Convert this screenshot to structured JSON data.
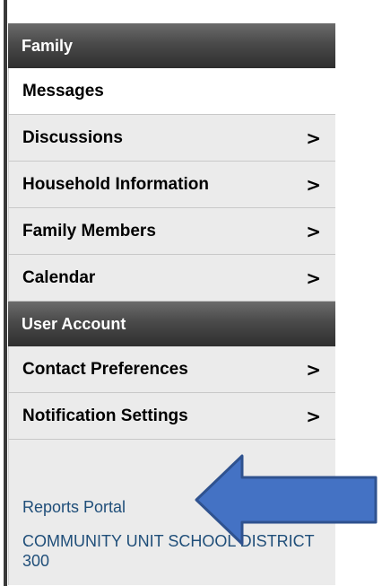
{
  "sidebar": {
    "family_header": "Family",
    "family_items": [
      {
        "label": "Messages",
        "arrow": ""
      },
      {
        "label": "Discussions",
        "arrow": ">"
      },
      {
        "label": "Household Information",
        "arrow": ">"
      },
      {
        "label": "Family Members",
        "arrow": ">"
      },
      {
        "label": "Calendar",
        "arrow": ">"
      }
    ],
    "user_header": "User Account",
    "user_items": [
      {
        "label": "Contact Preferences",
        "arrow": ">"
      },
      {
        "label": "Notification Settings",
        "arrow": ">"
      }
    ],
    "links": {
      "reports_portal": "Reports Portal",
      "district": "COMMUNITY UNIT SCHOOL DISTRICT 300"
    }
  },
  "annotation": {
    "arrow_fill": "#4472c4",
    "arrow_stroke": "#2f528f"
  }
}
